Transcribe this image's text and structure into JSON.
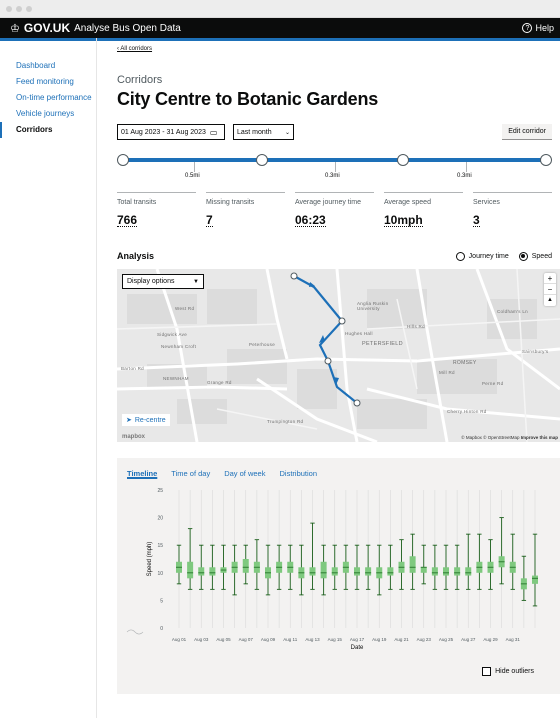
{
  "header": {
    "logo": "GOV.UK",
    "service_name": "Analyse Bus Open Data",
    "help_label": "Help"
  },
  "sidebar": {
    "items": [
      {
        "label": "Dashboard"
      },
      {
        "label": "Feed monitoring"
      },
      {
        "label": "On-time performance"
      },
      {
        "label": "Vehicle journeys"
      },
      {
        "label": "Corridors"
      }
    ]
  },
  "page": {
    "back_link": "All corridors",
    "caption": "Corridors",
    "title": "City Centre to Botanic Gardens",
    "date_range": "01 Aug 2023 - 31 Aug 2023",
    "period_select": "Last month",
    "edit_button": "Edit corridor"
  },
  "route": {
    "segments": [
      "0.5mi",
      "0.3mi",
      "0.3mi"
    ]
  },
  "stats": [
    {
      "label": "Total transits",
      "value": "766"
    },
    {
      "label": "Missing transits",
      "value": "7"
    },
    {
      "label": "Average journey time",
      "value": "06:23"
    },
    {
      "label": "Average speed",
      "value": "10mph"
    },
    {
      "label": "Services",
      "value": "3"
    }
  ],
  "analysis": {
    "heading": "Analysis",
    "radio_journey_time": "Journey time",
    "radio_speed": "Speed",
    "selected": "Speed"
  },
  "map": {
    "display_options": "Display options",
    "recentre": "Re-centre",
    "attribution": "© Mapbox © OpenStreetMap",
    "improve": "Improve this map",
    "mapbox_logo": "mapbox",
    "labels": [
      "West Rd",
      "Sidgwick Ave",
      "Newnham Croft",
      "Peterhouse",
      "NEWNHAM",
      "PETERSFIELD",
      "Anglia Ruskin University",
      "Hughes Hall",
      "ROMSEY",
      "Mill Rd",
      "Barton Rd",
      "Grange Rd",
      "Trumpington Rd",
      "Hills Rd",
      "Coldham's Ln",
      "Perne Rd",
      "Sainsbury's",
      "Cherry Hinton Rd"
    ],
    "zoom_in": "+",
    "zoom_out": "−"
  },
  "chart_tabs": [
    "Timeline",
    "Time of day",
    "Day of week",
    "Distribution"
  ],
  "hide_outliers": "Hide outliers",
  "chart_data": {
    "type": "box",
    "xlabel": "Date",
    "ylabel": "Speed (mph)",
    "ylim": [
      0,
      25
    ],
    "yticks": [
      0,
      5,
      10,
      15,
      20,
      25
    ],
    "x_tick_labels": [
      "Aug 01",
      "Aug 03",
      "Aug 05",
      "Aug 07",
      "Aug 09",
      "Aug 11",
      "Aug 13",
      "Aug 15",
      "Aug 17",
      "Aug 19",
      "Aug 21",
      "Aug 23",
      "Aug 25",
      "Aug 27",
      "Aug 29",
      "Aug 31"
    ],
    "days": [
      {
        "min": 8,
        "q1": 10,
        "median": 11,
        "q3": 12,
        "max": 15
      },
      {
        "min": 7,
        "q1": 9,
        "median": 10,
        "q3": 12,
        "max": 18
      },
      {
        "min": 7,
        "q1": 9.5,
        "median": 10,
        "q3": 11,
        "max": 15
      },
      {
        "min": 7,
        "q1": 9.5,
        "median": 10,
        "q3": 11,
        "max": 15
      },
      {
        "min": 7,
        "q1": 10,
        "median": 10.5,
        "q3": 11,
        "max": 15
      },
      {
        "min": 6,
        "q1": 10,
        "median": 11,
        "q3": 12,
        "max": 15
      },
      {
        "min": 8,
        "q1": 10,
        "median": 11,
        "q3": 12.5,
        "max": 15
      },
      {
        "min": 7,
        "q1": 10,
        "median": 11,
        "q3": 12,
        "max": 16
      },
      {
        "min": 6,
        "q1": 9,
        "median": 10,
        "q3": 11,
        "max": 15
      },
      {
        "min": 7,
        "q1": 10,
        "median": 11,
        "q3": 12,
        "max": 15
      },
      {
        "min": 7,
        "q1": 10,
        "median": 11,
        "q3": 12,
        "max": 15
      },
      {
        "min": 6,
        "q1": 9,
        "median": 10,
        "q3": 11,
        "max": 15
      },
      {
        "min": 7,
        "q1": 9.5,
        "median": 10,
        "q3": 11,
        "max": 19
      },
      {
        "min": 6,
        "q1": 9,
        "median": 10,
        "q3": 12,
        "max": 15
      },
      {
        "min": 7,
        "q1": 9.5,
        "median": 10,
        "q3": 11,
        "max": 15
      },
      {
        "min": 7,
        "q1": 10,
        "median": 11,
        "q3": 12,
        "max": 15
      },
      {
        "min": 7,
        "q1": 9.5,
        "median": 10,
        "q3": 11,
        "max": 15
      },
      {
        "min": 7,
        "q1": 9.5,
        "median": 10,
        "q3": 11,
        "max": 15
      },
      {
        "min": 6,
        "q1": 9,
        "median": 10,
        "q3": 11,
        "max": 15
      },
      {
        "min": 7,
        "q1": 9.5,
        "median": 10,
        "q3": 11,
        "max": 15
      },
      {
        "min": 7,
        "q1": 10,
        "median": 11,
        "q3": 12,
        "max": 16
      },
      {
        "min": 7,
        "q1": 10,
        "median": 11,
        "q3": 13,
        "max": 17
      },
      {
        "min": 8,
        "q1": 10,
        "median": 11,
        "q3": 11,
        "max": 15
      },
      {
        "min": 7,
        "q1": 9.5,
        "median": 10,
        "q3": 11,
        "max": 15
      },
      {
        "min": 7,
        "q1": 9.5,
        "median": 10,
        "q3": 11,
        "max": 15
      },
      {
        "min": 7,
        "q1": 9.5,
        "median": 10,
        "q3": 11,
        "max": 15
      },
      {
        "min": 7,
        "q1": 9.5,
        "median": 10,
        "q3": 11,
        "max": 17
      },
      {
        "min": 7,
        "q1": 10,
        "median": 11,
        "q3": 12,
        "max": 17
      },
      {
        "min": 7,
        "q1": 10,
        "median": 11,
        "q3": 12,
        "max": 16
      },
      {
        "min": 8,
        "q1": 11,
        "median": 12,
        "q3": 13,
        "max": 20
      },
      {
        "min": 7,
        "q1": 10,
        "median": 11,
        "q3": 12,
        "max": 17
      },
      {
        "min": 5,
        "q1": 7,
        "median": 8,
        "q3": 9,
        "max": 13
      },
      {
        "min": 4,
        "q1": 8,
        "median": 9,
        "q3": 9.5,
        "max": 17
      }
    ],
    "colors": {
      "box": "#7fc97f",
      "median": "#2e7d32",
      "whisker": "#1a5e1a"
    }
  },
  "colors": {
    "accent": "#1d70b8",
    "header": "#0b0c0c",
    "panel": "#f3f2f1"
  }
}
